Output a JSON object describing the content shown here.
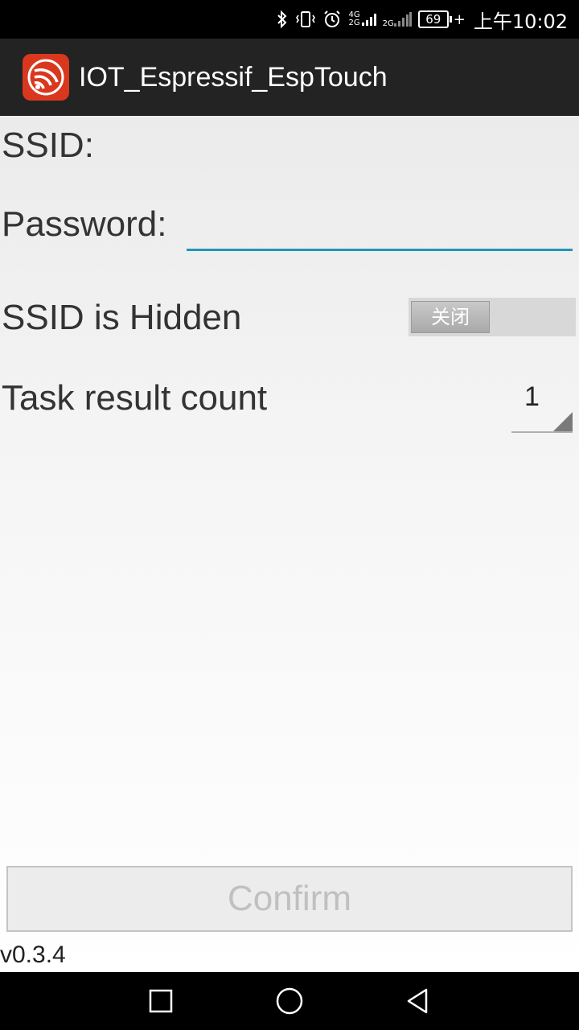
{
  "status_bar": {
    "network_1": "4G",
    "network_1b": "2G",
    "network_2": "2G",
    "battery_level": "69",
    "clock": "上午10:02"
  },
  "action_bar": {
    "app_icon": "espressif-logo-icon",
    "title": "IOT_Espressif_EspTouch",
    "accent_color": "#d9381e"
  },
  "form": {
    "ssid_label": "SSID:",
    "ssid_value": "",
    "password_label": "Password:",
    "password_value": "",
    "hidden_label": "SSID is Hidden",
    "hidden_toggle_text": "关闭",
    "count_label": "Task result count",
    "count_value": "1"
  },
  "confirm_button": "Confirm",
  "version": "v0.3.4",
  "nav_bar": {
    "recents_icon": "square-icon",
    "home_icon": "circle-icon",
    "back_icon": "triangle-back-icon"
  }
}
